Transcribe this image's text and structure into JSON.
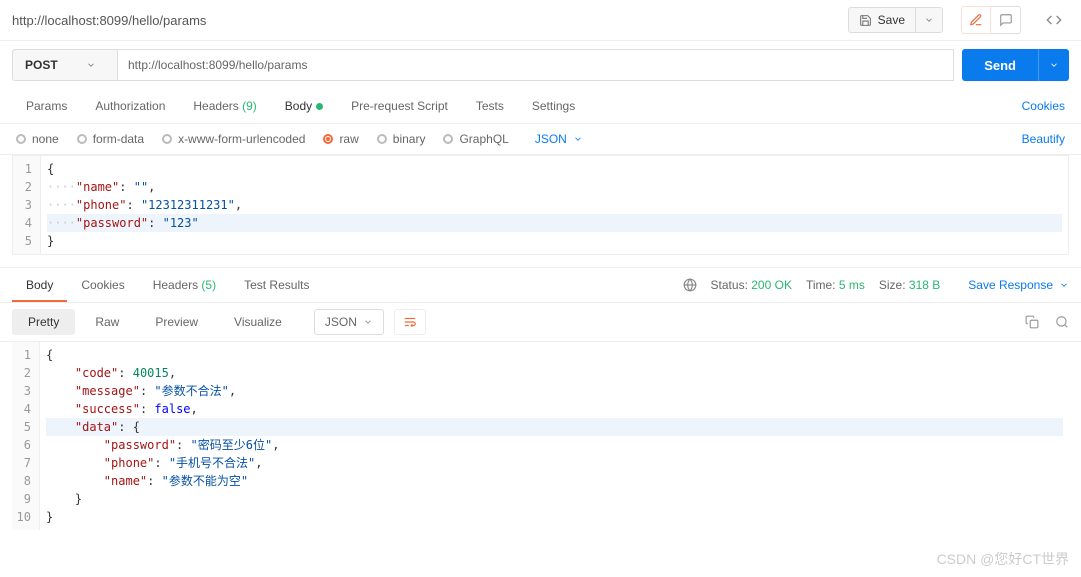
{
  "header": {
    "title": "http://localhost:8099/hello/params",
    "save": "Save"
  },
  "request": {
    "method": "POST",
    "url": "http://localhost:8099/hello/params",
    "send": "Send",
    "tabs": {
      "params": "Params",
      "auth": "Authorization",
      "headers": "Headers",
      "headers_count": "(9)",
      "body": "Body",
      "prerequest": "Pre-request Script",
      "tests": "Tests",
      "settings": "Settings",
      "cookies": "Cookies"
    },
    "body_types": {
      "none": "none",
      "form_data": "form-data",
      "xwww": "x-www-form-urlencoded",
      "raw": "raw",
      "binary": "binary",
      "graphql": "GraphQL",
      "json": "JSON",
      "beautify": "Beautify"
    },
    "body_json": {
      "lines": [
        "1",
        "2",
        "3",
        "4",
        "5"
      ],
      "name_key": "\"name\"",
      "name_val": "\"\"",
      "phone_key": "\"phone\"",
      "phone_val": "\"12312311231\"",
      "password_key": "\"password\"",
      "password_val": "\"123\""
    }
  },
  "response": {
    "tabs": {
      "body": "Body",
      "cookies": "Cookies",
      "headers": "Headers",
      "headers_count": "(5)",
      "test_results": "Test Results"
    },
    "status_label": "Status:",
    "status": "200 OK",
    "time_label": "Time:",
    "time": "5 ms",
    "size_label": "Size:",
    "size": "318 B",
    "save": "Save Response",
    "view": {
      "pretty": "Pretty",
      "raw": "Raw",
      "preview": "Preview",
      "visualize": "Visualize",
      "json": "JSON"
    },
    "json": {
      "lines": [
        "1",
        "2",
        "3",
        "4",
        "5",
        "6",
        "7",
        "8",
        "9",
        "10"
      ],
      "code_key": "\"code\"",
      "code_val": "40015",
      "message_key": "\"message\"",
      "message_val": "\"参数不合法\"",
      "success_key": "\"success\"",
      "success_val": "false",
      "data_key": "\"data\"",
      "password_key": "\"password\"",
      "password_val": "\"密码至少6位\"",
      "phone_key": "\"phone\"",
      "phone_val": "\"手机号不合法\"",
      "name_key": "\"name\"",
      "name_val": "\"参数不能为空\""
    }
  },
  "watermark": "CSDN @您好CT世界"
}
